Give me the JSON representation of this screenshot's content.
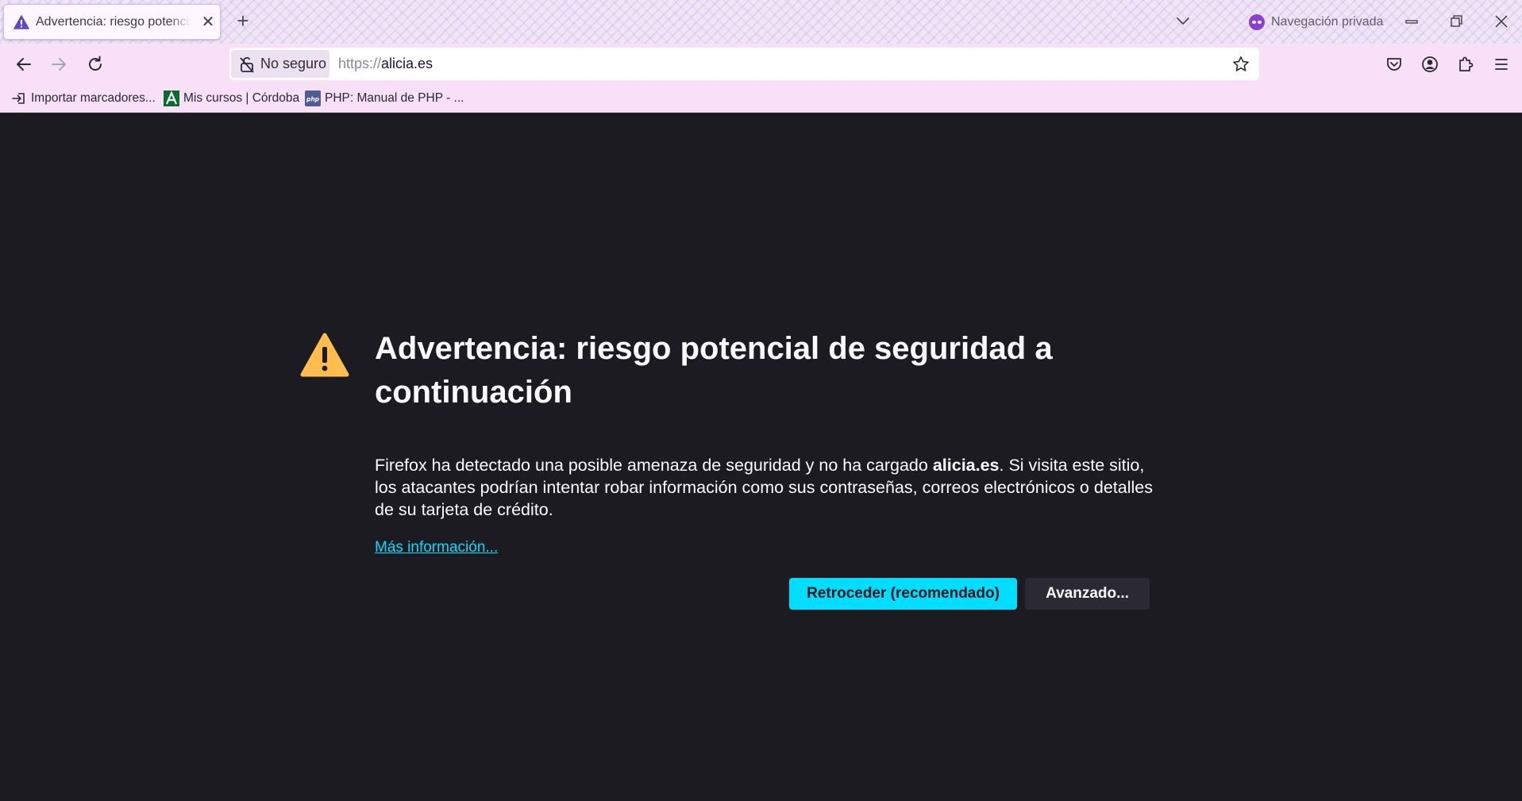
{
  "tab": {
    "title": "Advertencia: riesgo potencial de seguridad a continuación",
    "close_symbol": "✕",
    "icon": "warning-icon"
  },
  "tabstrip": {
    "new_tab_symbol": "+",
    "private_label": "Navegación privada"
  },
  "navbar": {
    "not_secure_label": "No seguro",
    "url_scheme": "https://",
    "url_host": "alicia.es"
  },
  "bookmarks": [
    {
      "label": "Importar marcadores...",
      "icon": "import-icon"
    },
    {
      "label": "Mis cursos | Córdoba",
      "icon": "andalucia-logo-icon"
    },
    {
      "label": "PHP: Manual de PHP - ...",
      "icon": "php-icon"
    }
  ],
  "page": {
    "title": "Advertencia: riesgo potencial de seguridad a continuación",
    "desc_before": "Firefox ha detectado una posible amenaza de seguridad y no ha cargado ",
    "desc_host": "alicia.es",
    "desc_after": ". Si visita este sitio, los atacantes podrían intentar robar información como sus contraseñas, correos electrónicos o detalles de su tarjeta de crédito.",
    "more_info": "Más información...",
    "back_button": "Retroceder (recomendado)",
    "advanced_button": "Avanzado..."
  },
  "colors": {
    "accent": "#00ddff",
    "warning": "#ffbd4f",
    "private_purple": "#8a3fd1",
    "content_bg": "#1c1b22"
  }
}
